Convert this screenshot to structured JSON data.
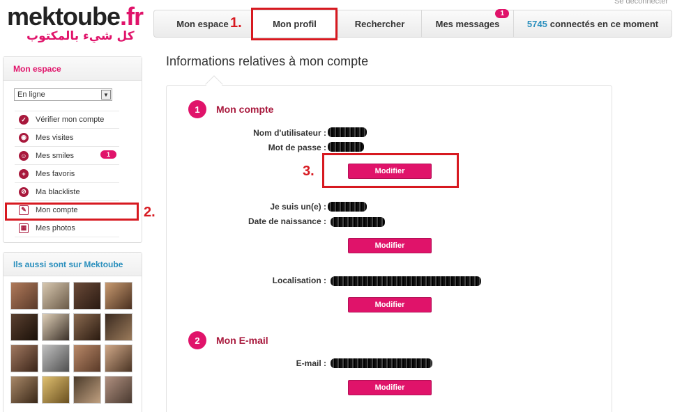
{
  "logo": {
    "name": "mektoube",
    "tld": ".fr",
    "tagline": "كل شيء بالمكتوب"
  },
  "header": {
    "logout_label": "Se déconnecter"
  },
  "nav": {
    "espace": "Mon espace",
    "profil": "Mon profil",
    "recherche": "Rechercher",
    "messages": "Mes messages",
    "messages_badge": "1",
    "online_count": "5745",
    "online_label": "connectés en ce moment"
  },
  "annotations": {
    "step1": "1.",
    "step2": "2.",
    "step3": "3."
  },
  "sidebar": {
    "espace_title": "Mon espace",
    "status_value": "En ligne",
    "items": [
      {
        "label": "Vérifier mon compte",
        "icon": "check-icon"
      },
      {
        "label": "Mes visites",
        "icon": "eye-icon"
      },
      {
        "label": "Mes smiles",
        "icon": "smile-icon",
        "badge": "1"
      },
      {
        "label": "Mes favoris",
        "icon": "plus-icon"
      },
      {
        "label": "Ma blackliste",
        "icon": "block-icon"
      },
      {
        "label": "Mon compte",
        "icon": "edit-icon"
      },
      {
        "label": "Mes photos",
        "icon": "photos-icon"
      }
    ],
    "members_title": "Ils aussi sont sur Mektoube"
  },
  "main": {
    "title": "Informations relatives à mon compte",
    "section1": {
      "num": "1",
      "title": "Mon compte",
      "username_label": "Nom d'utilisateur :",
      "password_label": "Mot de passe :",
      "gender_label": "Je suis un(e) :",
      "birthdate_label": "Date de naissance :",
      "location_label": "Localisation :"
    },
    "section2": {
      "num": "2",
      "title": "Mon E-mail",
      "email_label": "E-mail :"
    },
    "modify_label": "Modifier"
  },
  "colors": {
    "brand_pink": "#e0136a",
    "dark_pink": "#a8183c",
    "online_blue": "#2a8fbd",
    "annotation_red": "#d71920"
  }
}
